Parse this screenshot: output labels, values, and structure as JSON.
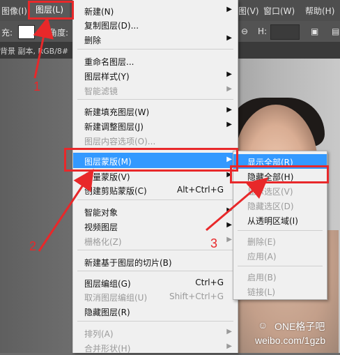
{
  "menubar": {
    "image_label": "图像(I)",
    "layer_label": "图层(L)",
    "view_label": "图(V)",
    "window_label": "窗口(W)",
    "help_label": "帮助(H)"
  },
  "optbar": {
    "fill_label": "充:",
    "angle_label": "角度:",
    "h_label": "H:"
  },
  "tab": {
    "title": "背景 副本, RGB/8#"
  },
  "layer_menu": [
    {
      "label": "新建(N)",
      "shortcut": "",
      "arrow": true,
      "disabled": false,
      "highlight": false
    },
    {
      "label": "复制图层(D)...",
      "shortcut": "",
      "arrow": false,
      "disabled": false,
      "highlight": false
    },
    {
      "label": "删除",
      "shortcut": "",
      "arrow": true,
      "disabled": false,
      "highlight": false
    },
    {
      "label": "重命名图层...",
      "shortcut": "",
      "arrow": false,
      "disabled": false,
      "highlight": false
    },
    {
      "label": "图层样式(Y)",
      "shortcut": "",
      "arrow": true,
      "disabled": false,
      "highlight": false
    },
    {
      "label": "智能滤镜",
      "shortcut": "",
      "arrow": true,
      "disabled": true,
      "highlight": false
    },
    {
      "label": "新建填充图层(W)",
      "shortcut": "",
      "arrow": true,
      "disabled": false,
      "highlight": false
    },
    {
      "label": "新建调整图层(J)",
      "shortcut": "",
      "arrow": true,
      "disabled": false,
      "highlight": false
    },
    {
      "label": "图层内容选项(O)...",
      "shortcut": "",
      "arrow": false,
      "disabled": true,
      "highlight": false
    },
    {
      "label": "图层蒙版(M)",
      "shortcut": "",
      "arrow": true,
      "disabled": false,
      "highlight": true
    },
    {
      "label": "矢量蒙版(V)",
      "shortcut": "",
      "arrow": true,
      "disabled": false,
      "highlight": false
    },
    {
      "label": "创建剪贴蒙版(C)",
      "shortcut": "Alt+Ctrl+G",
      "arrow": false,
      "disabled": false,
      "highlight": false
    },
    {
      "label": "智能对象",
      "shortcut": "",
      "arrow": true,
      "disabled": false,
      "highlight": false
    },
    {
      "label": "视频图层",
      "shortcut": "",
      "arrow": true,
      "disabled": false,
      "highlight": false
    },
    {
      "label": "栅格化(Z)",
      "shortcut": "",
      "arrow": true,
      "disabled": true,
      "highlight": false
    },
    {
      "label": "新建基于图层的切片(B)",
      "shortcut": "",
      "arrow": false,
      "disabled": false,
      "highlight": false
    },
    {
      "label": "图层编组(G)",
      "shortcut": "Ctrl+G",
      "arrow": false,
      "disabled": false,
      "highlight": false
    },
    {
      "label": "取消图层编组(U)",
      "shortcut": "Shift+Ctrl+G",
      "arrow": false,
      "disabled": true,
      "highlight": false
    },
    {
      "label": "隐藏图层(R)",
      "shortcut": "",
      "arrow": false,
      "disabled": false,
      "highlight": false
    },
    {
      "label": "排列(A)",
      "shortcut": "",
      "arrow": true,
      "disabled": true,
      "highlight": false
    },
    {
      "label": "合并形状(H)",
      "shortcut": "",
      "arrow": true,
      "disabled": true,
      "highlight": false
    }
  ],
  "mask_submenu": [
    {
      "label": "显示全部(R)",
      "disabled": false,
      "highlight": true
    },
    {
      "label": "隐藏全部(H)",
      "disabled": false,
      "highlight": false
    },
    {
      "label": "显示选区(V)",
      "disabled": true,
      "highlight": false
    },
    {
      "label": "隐藏选区(D)",
      "disabled": true,
      "highlight": false
    },
    {
      "label": "从透明区域(I)",
      "disabled": false,
      "highlight": false
    },
    {
      "label": "删除(E)",
      "disabled": true,
      "highlight": false
    },
    {
      "label": "应用(A)",
      "disabled": true,
      "highlight": false
    },
    {
      "label": "启用(B)",
      "disabled": true,
      "highlight": false
    },
    {
      "label": "链接(L)",
      "disabled": true,
      "highlight": false
    }
  ],
  "annotations": {
    "step1": "1",
    "step2": "2",
    "step3": "3",
    "color": "#e8282a"
  },
  "watermark": {
    "name": "ONE格子吧",
    "url": "weibo.com/1gzb"
  },
  "colors": {
    "highlight": "#3399ff",
    "menu_bg": "#f0f0f0",
    "menubar_bg": "#4e4e4e"
  }
}
